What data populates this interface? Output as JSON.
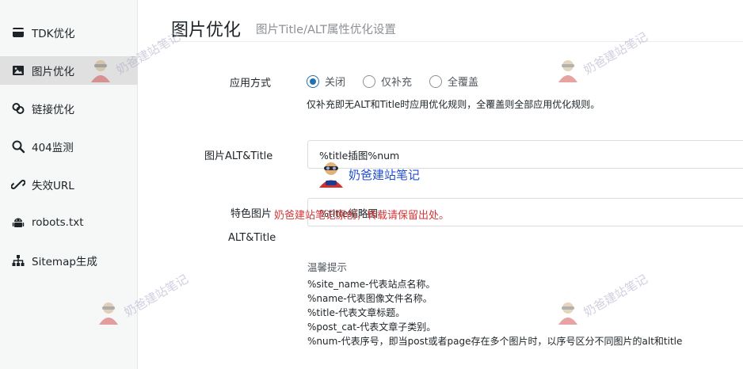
{
  "sidebar": {
    "items": [
      {
        "label": "TDK优化",
        "icon": "tdk-icon"
      },
      {
        "label": "图片优化",
        "icon": "image-icon",
        "active": true
      },
      {
        "label": "链接优化",
        "icon": "link-icon"
      },
      {
        "label": "404监测",
        "icon": "search-icon"
      },
      {
        "label": "失效URL",
        "icon": "broken-link-icon"
      },
      {
        "label": "robots.txt",
        "icon": "android-icon"
      },
      {
        "label": "Sitemap生成",
        "icon": "sitemap-icon"
      }
    ]
  },
  "header": {
    "title": "图片优化",
    "subtitle": "图片Title/ALT属性优化设置"
  },
  "form": {
    "apply_mode": {
      "label": "应用方式",
      "options": [
        "关闭",
        "仅补充",
        "全覆盖"
      ],
      "selected": "关闭",
      "description": "仅补充即无ALT和Title时应用优化规则，全覆盖则全部应用优化规则。"
    },
    "image_alt_title": {
      "label": "图片ALT&Title",
      "value": "%title插图%num"
    },
    "featured_alt_title": {
      "label_line1": "特色图片",
      "label_line2": "ALT&Title",
      "value": "%title缩略图"
    }
  },
  "tips": {
    "title": "温馨提示",
    "lines": [
      "%site_name-代表站点名称。",
      "%name-代表图像文件名称。",
      "%title-代表文章标题。",
      "%post_cat-代表文章子类别。",
      "%num-代表序号，即当post或者page存在多个图片时，以序号区分不同图片的alt和title"
    ]
  },
  "watermark": {
    "text": "奶爸建站笔记",
    "notice": "奶爸建站笔记原创，转载请保留出处。"
  },
  "colors": {
    "accent": "#2271b1",
    "notice": "#d63638",
    "watermark_blue": "#1f4fd1",
    "sidebar_bg": "#f6f7f7",
    "active_bg": "#e0e0e0"
  }
}
